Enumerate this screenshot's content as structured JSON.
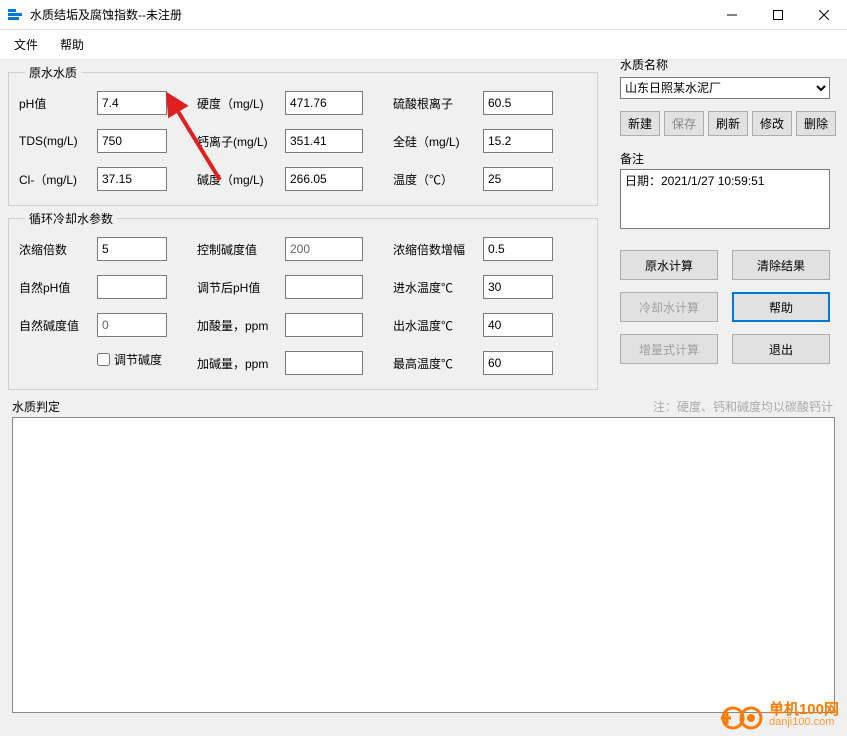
{
  "window": {
    "title": "水质结垢及腐蚀指数--未注册"
  },
  "menu": {
    "file": "文件",
    "help": "帮助"
  },
  "group_raw": {
    "legend": "原水水质",
    "ph_label": "pH值",
    "ph_value": "7.4",
    "tds_label": "TDS(mg/L)",
    "tds_value": "750",
    "cl_label": "Cl-（mg/L)",
    "cl_value": "37.15",
    "hardness_label": "硬度（mg/L)",
    "hardness_value": "471.76",
    "ca_label": "钙离子(mg/L)",
    "ca_value": "351.41",
    "alk_label": "碱度（mg/L)",
    "alk_value": "266.05",
    "so4_label": "硫酸根离子",
    "so4_value": "60.5",
    "si_label": "全硅（mg/L)",
    "si_value": "15.2",
    "temp_label": "温度（℃）",
    "temp_value": "25"
  },
  "group_cycle": {
    "legend": "循环冷却水参数",
    "conc_label": "浓缩倍数",
    "conc_value": "5",
    "natph_label": "自然pH值",
    "natph_value": "",
    "natalk_label": "自然碱度值",
    "natalk_value": "0",
    "adjalk_chk_label": "调节碱度",
    "ctlalk_label": "控制碱度值",
    "ctlalk_value": "200",
    "adjph_label": "调节后pH值",
    "adjph_value": "",
    "acid_label": "加酸量，ppm",
    "acid_value": "",
    "base_label": "加碱量，ppm",
    "base_value": "",
    "concinc_label": "浓缩倍数增幅",
    "concinc_value": "0.5",
    "tin_label": "进水温度℃",
    "tin_value": "30",
    "tout_label": "出水温度℃",
    "tout_value": "40",
    "tmax_label": "最高温度℃",
    "tmax_value": "60"
  },
  "right": {
    "name_label": "水质名称",
    "selected_name": "山东日照某水泥厂",
    "toolbar": {
      "newbtn": "新建",
      "save": "保存",
      "refresh": "刷新",
      "modify": "修改",
      "del": "删除"
    },
    "remark_label": "备注",
    "remark_value": "日期：2021/1/27 10:59:51",
    "btn_rawcalc": "原水计算",
    "btn_clear": "清除结果",
    "btn_coolcalc": "冷却水计算",
    "btn_help": "帮助",
    "btn_inc": "增量式计算",
    "btn_exit": "退出"
  },
  "judgment": {
    "label": "水质判定",
    "note": "注：硬度、钙和碱度均以碳酸钙计"
  },
  "watermark": {
    "line1": "单机100网",
    "line2": "danji100.com"
  }
}
